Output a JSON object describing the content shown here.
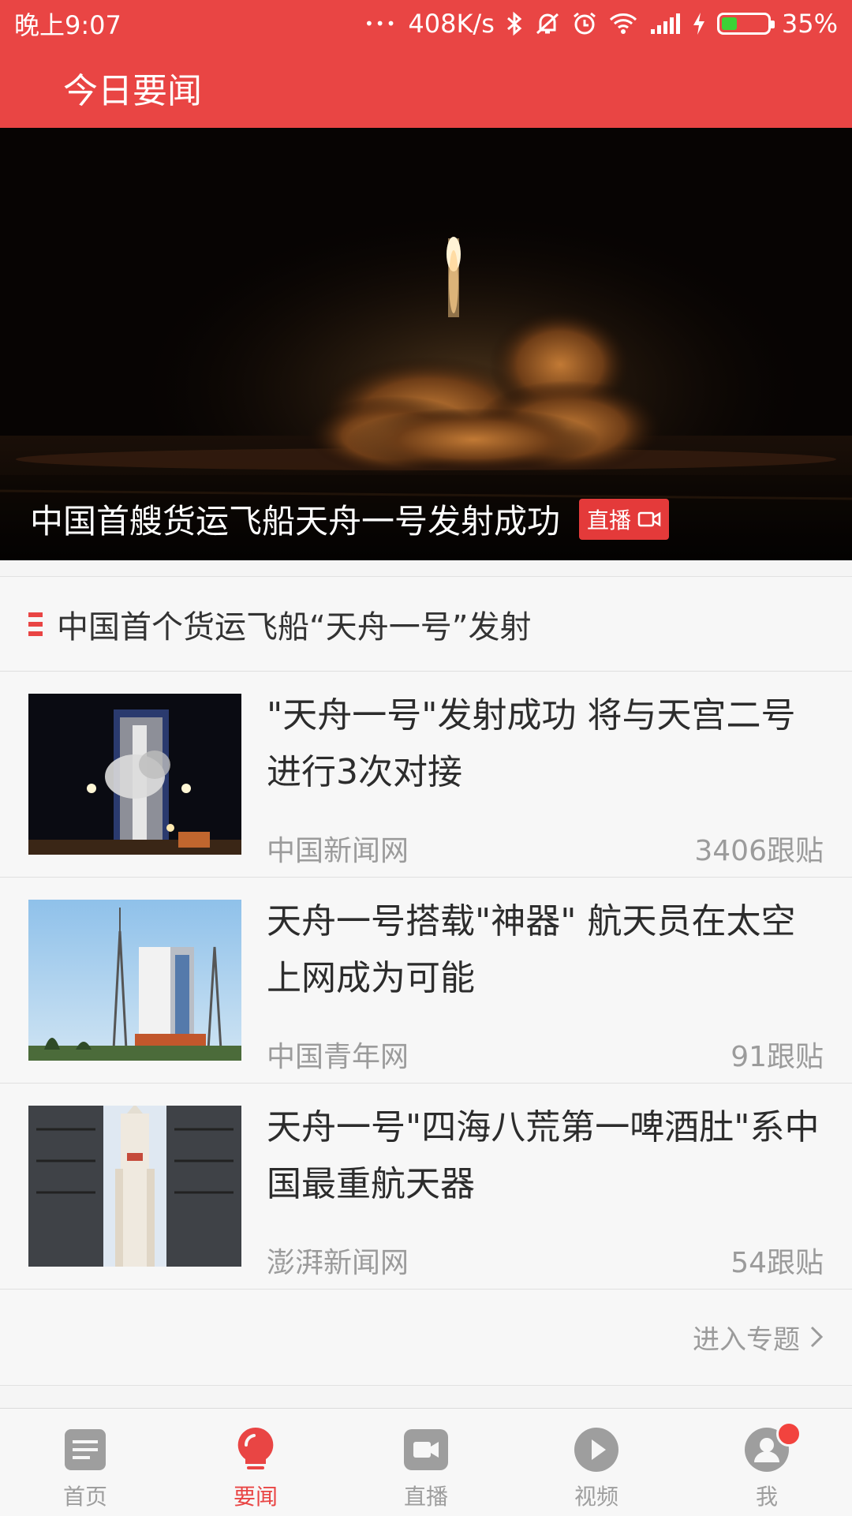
{
  "status_bar": {
    "time": "晚上9:07",
    "dots": "•••",
    "network_speed": "408K/s",
    "battery_percent": "35%",
    "battery_level": 0.35
  },
  "header": {
    "title": "今日要闻"
  },
  "hero": {
    "caption": "中国首艘货运飞船天舟一号发射成功",
    "badge": "直播"
  },
  "topic": {
    "title": "中国首个货运飞船“天舟一号”发射",
    "articles": [
      {
        "title": "\"天舟一号\"发射成功 将与天宫二号进行3次对接",
        "source": "中国新闻网",
        "comments": "3406跟贴"
      },
      {
        "title": "天舟一号搭载\"神器\" 航天员在太空上网成为可能",
        "source": "中国青年网",
        "comments": "91跟贴"
      },
      {
        "title": "天舟一号\"四海八荒第一啤酒肚\"系中国最重航天器",
        "source": "澎湃新闻网",
        "comments": "54跟贴"
      }
    ],
    "enter_label": "进入专题"
  },
  "bottom_nav": {
    "items": [
      {
        "label": "首页",
        "icon": "document-icon"
      },
      {
        "label": "要闻",
        "icon": "lightbulb-icon",
        "active": true
      },
      {
        "label": "直播",
        "icon": "video-camera-icon"
      },
      {
        "label": "视频",
        "icon": "play-icon"
      },
      {
        "label": "我",
        "icon": "user-icon",
        "badge": true
      }
    ]
  },
  "colors": {
    "brand_red": "#e94544",
    "text_gray": "#9b9b9b"
  }
}
